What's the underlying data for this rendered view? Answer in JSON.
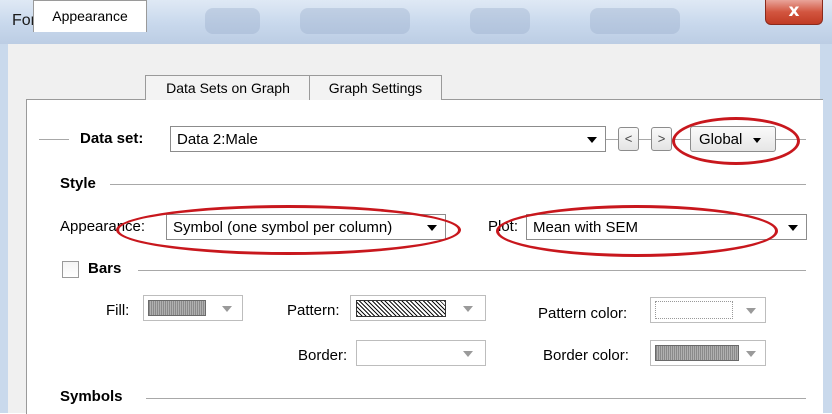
{
  "window": {
    "title": "Format Graph",
    "close_glyph": "x"
  },
  "tabs": [
    {
      "label": "Appearance",
      "active": true
    },
    {
      "label": "Data Sets on Graph",
      "active": false
    },
    {
      "label": "Graph Settings",
      "active": false
    }
  ],
  "dataset": {
    "label": "Data set:",
    "value": "Data 2:Male",
    "prev_glyph": "<",
    "next_glyph": ">",
    "scope_button": "Global"
  },
  "style": {
    "heading": "Style",
    "appearance_label": "Appearance:",
    "appearance_value": "Symbol (one symbol per column)",
    "plot_label": "Plot:",
    "plot_value": "Mean with SEM"
  },
  "bars": {
    "label": "Bars",
    "checked": false,
    "fill_label": "Fill:",
    "pattern_label": "Pattern:",
    "pattern_color_label": "Pattern color:",
    "border_label": "Border:",
    "border_color_label": "Border color:"
  },
  "symbols": {
    "heading": "Symbols"
  },
  "annotation_color": "#c8171d"
}
